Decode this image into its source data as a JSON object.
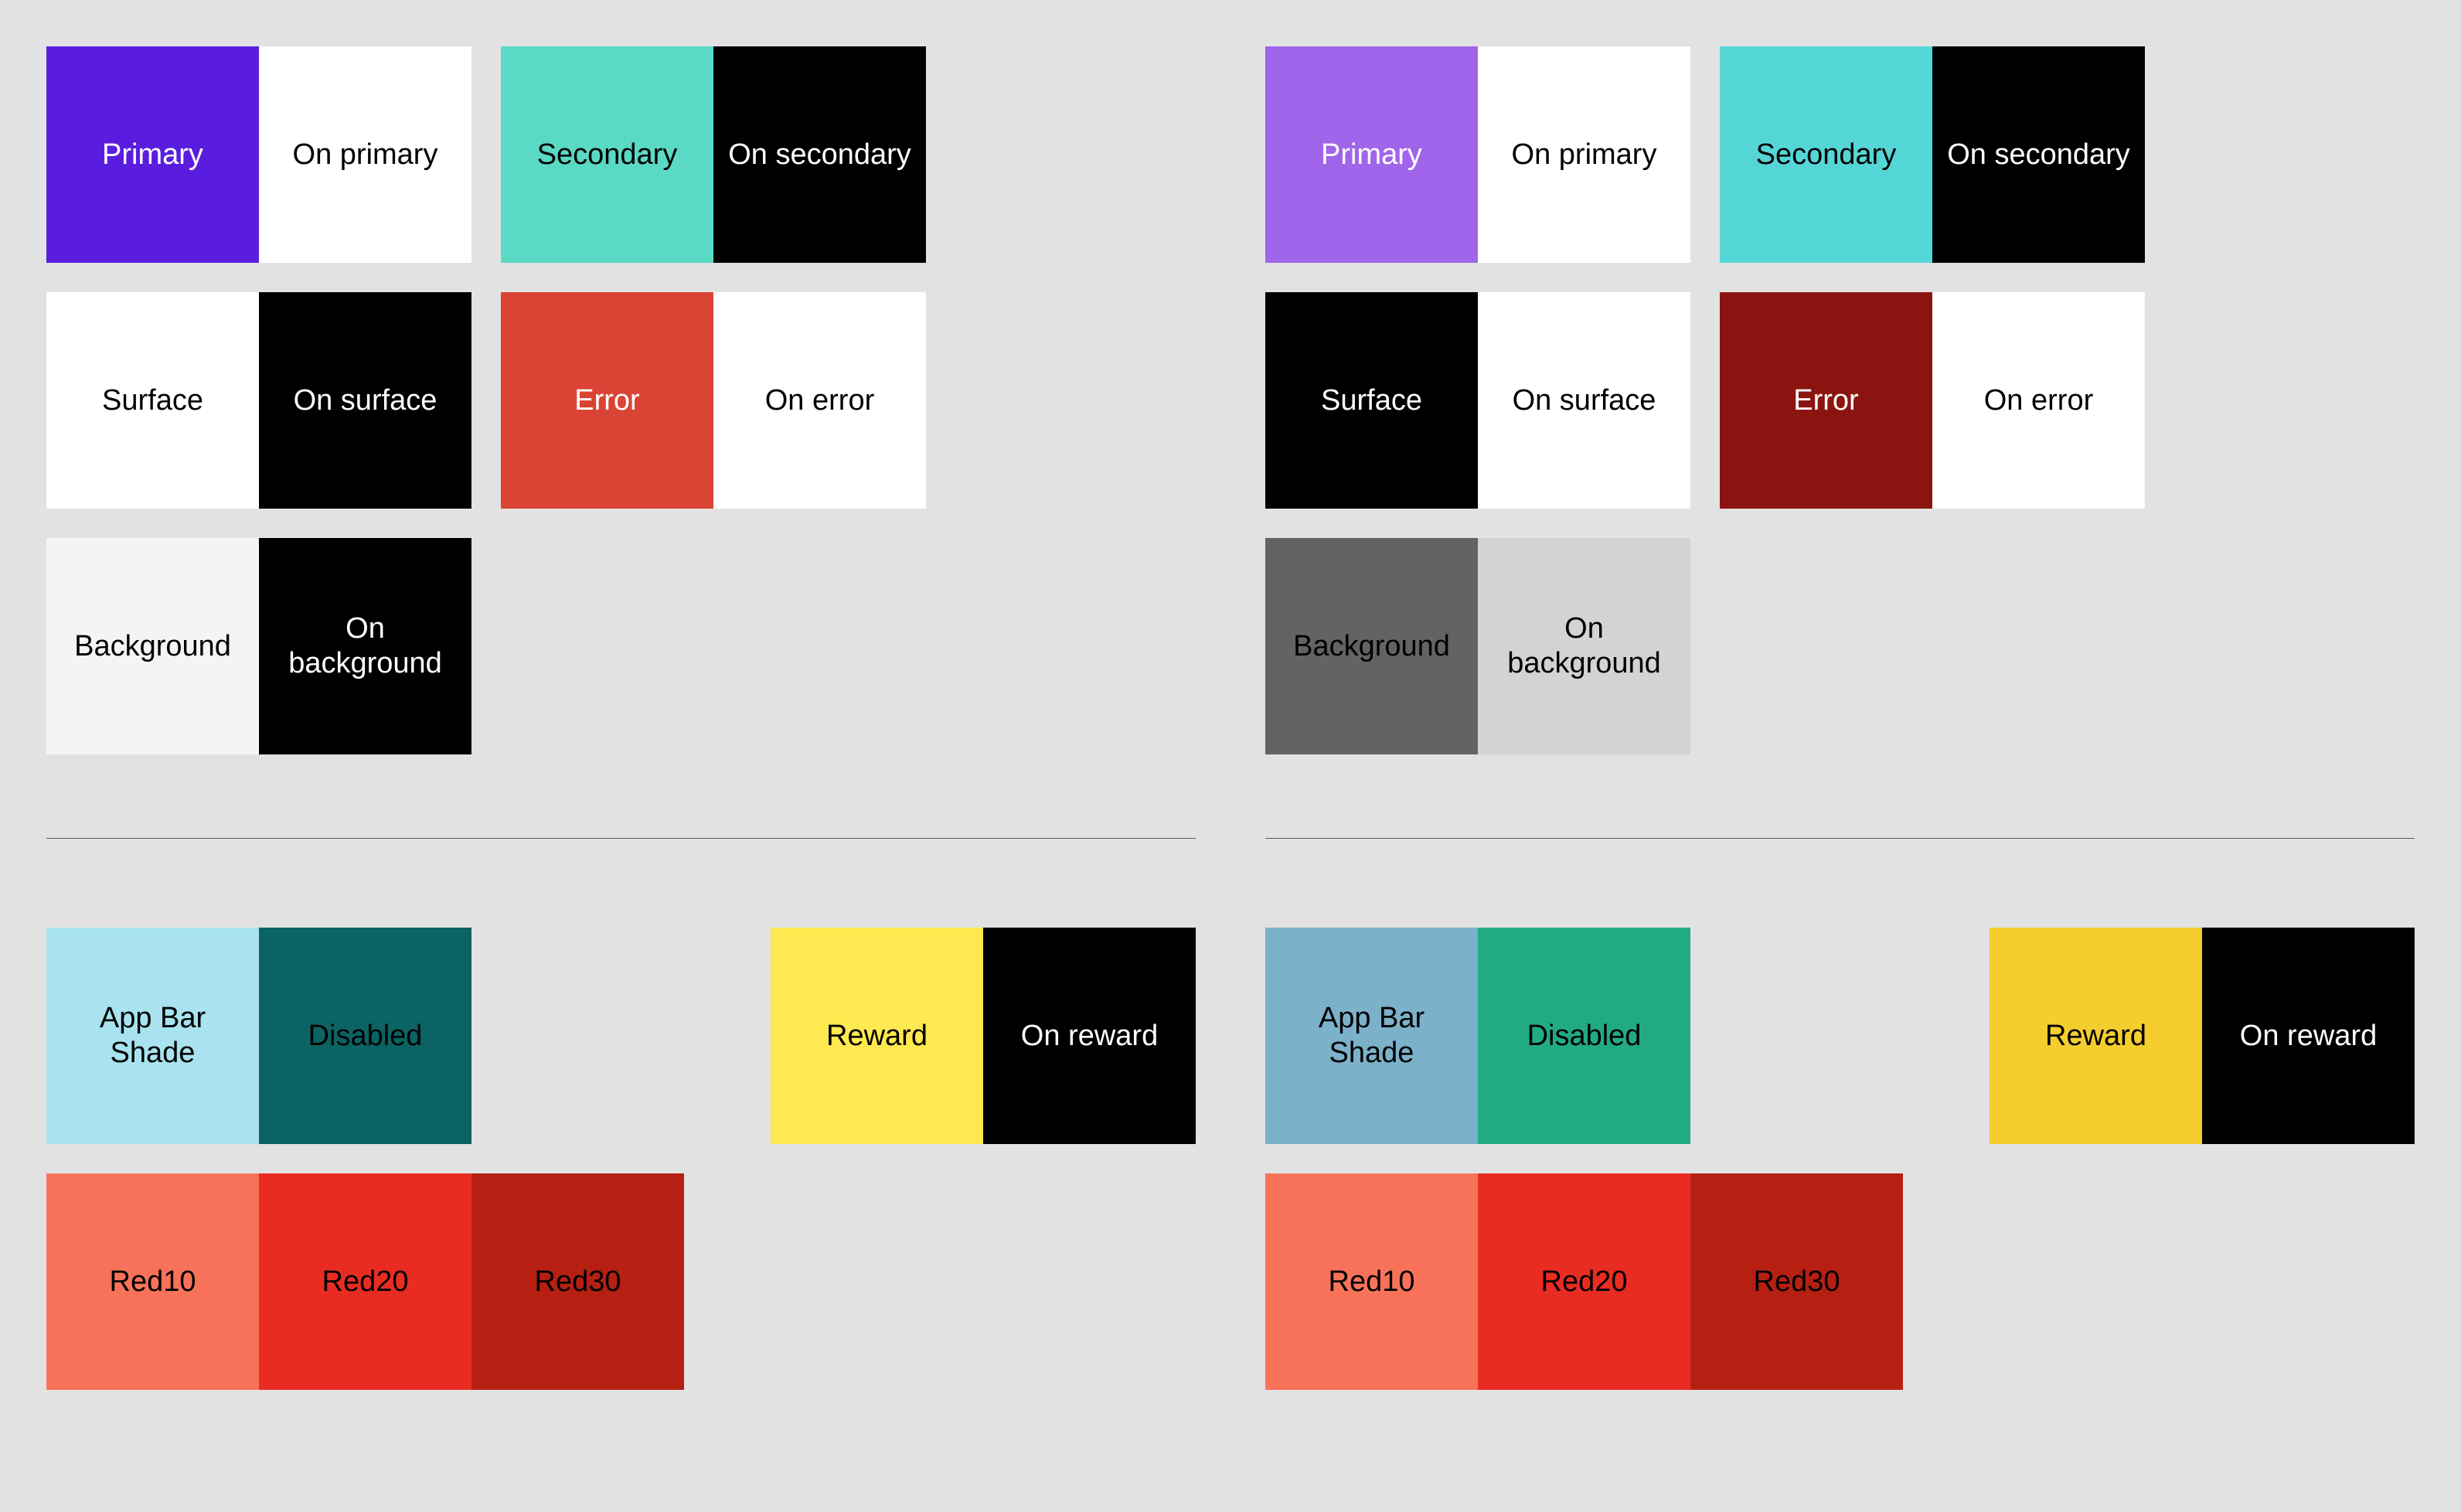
{
  "left": {
    "group1": [
      [
        {
          "label": "Primary",
          "bg": "#5a1de0",
          "fg": "#ffffff"
        },
        {
          "label": "On primary",
          "bg": "#ffffff",
          "fg": "#000000"
        },
        {
          "label": "Secondary",
          "bg": "#5ad9c5",
          "fg": "#000000"
        },
        {
          "label": "On secondary",
          "bg": "#000000",
          "fg": "#ffffff"
        }
      ],
      [
        {
          "label": "Surface",
          "bg": "#ffffff",
          "fg": "#000000"
        },
        {
          "label": "On surface",
          "bg": "#000000",
          "fg": "#ffffff"
        },
        {
          "label": "Error",
          "bg": "#da4435",
          "fg": "#ffffff"
        },
        {
          "label": "On error",
          "bg": "#ffffff",
          "fg": "#000000"
        }
      ],
      [
        {
          "label": "Background",
          "bg": "#f5f3f3",
          "fg": "#000000"
        },
        {
          "label": "On background",
          "bg": "#000000",
          "fg": "#ffffff"
        }
      ]
    ],
    "group2_pairs": [
      {
        "a": {
          "label": "App Bar Shade",
          "bg": "#a8e3ef",
          "fg": "#000000"
        },
        "b": {
          "label": "Disabled",
          "bg": "#0b6363",
          "fg": "#000000"
        }
      },
      {
        "a": {
          "label": "Reward",
          "bg": "#ffe950",
          "fg": "#000000"
        },
        "b": {
          "label": "On reward",
          "bg": "#000000",
          "fg": "#ffffff"
        }
      }
    ],
    "group2_reds": [
      {
        "label": "Red10",
        "bg": "#f8725a",
        "fg": "#000000"
      },
      {
        "label": "Red20",
        "bg": "#e82c22",
        "fg": "#000000"
      },
      {
        "label": "Red30",
        "bg": "#b52013",
        "fg": "#000000"
      }
    ]
  },
  "right": {
    "group1": [
      [
        {
          "label": "Primary",
          "bg": "#a065ea",
          "fg": "#ffffff"
        },
        {
          "label": "On primary",
          "bg": "#ffffff",
          "fg": "#000000"
        },
        {
          "label": "Secondary",
          "bg": "#55d6d6",
          "fg": "#000000"
        },
        {
          "label": "On secondary",
          "bg": "#000000",
          "fg": "#ffffff"
        }
      ],
      [
        {
          "label": "Surface",
          "bg": "#000000",
          "fg": "#ffffff"
        },
        {
          "label": "On surface",
          "bg": "#ffffff",
          "fg": "#000000"
        },
        {
          "label": "Error",
          "bg": "#8b1410",
          "fg": "#ffffff"
        },
        {
          "label": "On error",
          "bg": "#ffffff",
          "fg": "#000000"
        }
      ],
      [
        {
          "label": "Background",
          "bg": "#636363",
          "fg": "#000000"
        },
        {
          "label": "On background",
          "bg": "#d3d3d3",
          "fg": "#000000"
        }
      ]
    ],
    "group2_pairs": [
      {
        "a": {
          "label": "App Bar Shade",
          "bg": "#7cb1ca",
          "fg": "#000000"
        },
        "b": {
          "label": "Disabled",
          "bg": "#22ab83",
          "fg": "#000000"
        }
      },
      {
        "a": {
          "label": "Reward",
          "bg": "#f4ce2e",
          "fg": "#000000"
        },
        "b": {
          "label": "On reward",
          "bg": "#000000",
          "fg": "#ffffff"
        }
      }
    ],
    "group2_reds": [
      {
        "label": "Red10",
        "bg": "#f8725a",
        "fg": "#000000"
      },
      {
        "label": "Red20",
        "bg": "#e82c22",
        "fg": "#000000"
      },
      {
        "label": "Red30",
        "bg": "#b52013",
        "fg": "#000000"
      }
    ]
  }
}
